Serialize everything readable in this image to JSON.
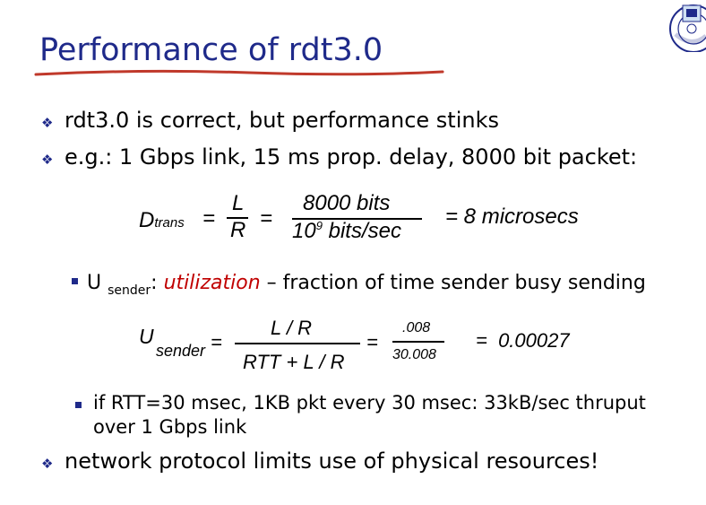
{
  "title": "Performance of rdt3.0",
  "bullets": [
    "rdt3.0 is correct, but performance stinks",
    "e.g.: 1 Gbps link, 15 ms prop. delay, 8000 bit packet:",
    "network protocol limits use of physical resources!"
  ],
  "dtrans": {
    "lhs": "D",
    "lhs_sub": "trans",
    "eq1": "=",
    "num1": "L",
    "den1": "R",
    "eq2": "=",
    "num2": "8000 bits",
    "den2_base": "10",
    "den2_exp": "9",
    "den2_rest": " bits/sec",
    "result": "= 8 microsecs"
  },
  "sub_bullet_1": {
    "u": "U ",
    "u_sub": "sender",
    "colon": ": ",
    "term": "utilization",
    "rest": " – fraction of time sender busy sending"
  },
  "usender": {
    "lhs": "U",
    "lhs_sub": "sender",
    "eq1": "=",
    "num1": "L / R",
    "den1": "RTT + L / R",
    "eq2": "=",
    "num2": ".008",
    "den2": "30.008",
    "result": "=  0.00027"
  },
  "sub_bullet_2": "if RTT=30 msec, 1KB pkt every 30 msec: 33kB/sec thruput over 1 Gbps link",
  "colors": {
    "title": "#1f2a8a",
    "underline": "#c0392b",
    "highlight": "#c00000",
    "bullet": "#1f2a8a"
  }
}
